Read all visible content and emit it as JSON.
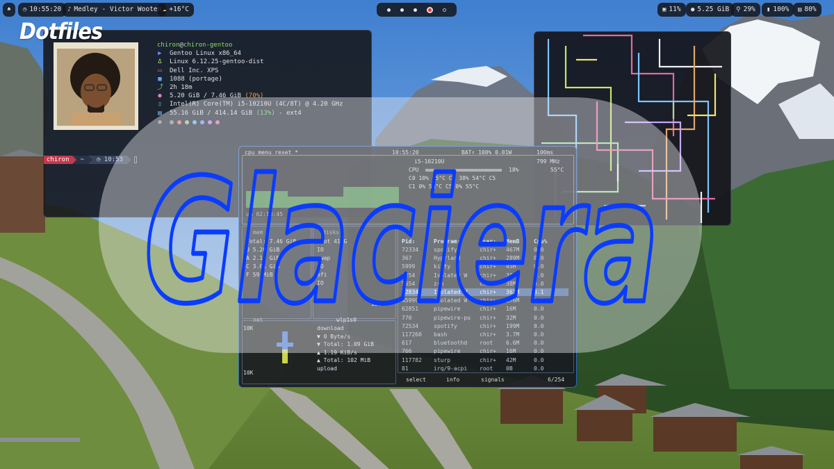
{
  "topbar": {
    "time": "10:55:20",
    "media": "Medley - Victor Wooten",
    "weather": "+16°C",
    "workspaces": [
      "ws1",
      "ws2",
      "ws3",
      "ws4",
      "ws5"
    ],
    "active_workspace": 4,
    "brightness": "11%",
    "memory": "5.25 GiB",
    "cpu": "29%",
    "volume": "100%",
    "battery": "80%"
  },
  "overlay_label": "Dotfiles",
  "logo_text": "Glaciera",
  "fetch": {
    "user": "chiron",
    "host": "chiron-gentoo",
    "rows": [
      {
        "icon": "▶",
        "color": "#6f8cff",
        "text": "Gentoo Linux x86_64"
      },
      {
        "icon": "Δ",
        "color": "#9bd86a",
        "text": "Linux 6.12.25-gentoo-dist"
      },
      {
        "icon": "▭",
        "color": "#e56a8c",
        "text": "Dell Inc. XPS"
      },
      {
        "icon": "■",
        "color": "#5ea8ff",
        "text": "1088 (portage)"
      },
      {
        "icon": "⤴",
        "color": "#7ad27a",
        "text": "2h 18m"
      },
      {
        "icon": "●",
        "color": "#e080c0",
        "text": "5.20 GiB / 7.46 GiB",
        "pct": "(70%)"
      },
      {
        "icon": "▯",
        "color": "#8fa8ff",
        "text": "Intel(R) Core(TM) i5-10210U (4C/8T) @ 4.20 GHz"
      },
      {
        "icon": "▤",
        "color": "#7ec7ff",
        "text": "55.16 GiB / 414.14 GiB",
        "pct": "(13%)",
        "suffix": " - ext4"
      }
    ],
    "palette": [
      "#888888",
      "#e06c75",
      "#98c379",
      "#61afef",
      "#7d8cff",
      "#c678dd",
      "#e06c9c"
    ],
    "prompt": {
      "user": "chiron",
      "dir": "~",
      "time": "10:53"
    }
  },
  "btop": {
    "header_left": "cpu  menu  reset *",
    "clock": "10:55:20",
    "header_right": "BAT↑ 100% 0.01W",
    "freq": "799 MHz",
    "cpu_model": "i5-10210U",
    "cpu_pct": "18%",
    "temp": "55°C",
    "core_rows": [
      "C0  10%  55°C  C4  38%  54°C  C5",
      "C1  0%  53°C  C5  0%  55°C"
    ],
    "uptime": "up 02:18:45",
    "mem_label": "mem",
    "mem_rows": [
      "Total:  7.46 GiB",
      "U    5.26 GiB",
      "A    2.18 GiB",
      "C    3.01 GiB",
      "F    59 MiB"
    ],
    "disk_label": "disks",
    "disk_rows": [
      "root  414G",
      "IO",
      "swap",
      "IO",
      "efi",
      "IO"
    ],
    "disk_io": "156K",
    "proc_header": [
      "Pid:",
      "Program:",
      "User:",
      "MemB",
      "Cpu%"
    ],
    "procs": [
      [
        "72334",
        "spotify",
        "chir+",
        "467M",
        "0.0"
      ],
      [
        "367",
        "Hyprland",
        "chir+",
        "289M",
        "0.0"
      ],
      [
        "5999",
        "kitty",
        "chir+",
        "45M",
        "0.0"
      ],
      [
        "3254",
        "Isolated W",
        "chir+",
        "380M",
        "0.0"
      ],
      [
        "5654",
        "zsh",
        "chir+",
        "38M",
        "0.0"
      ],
      [
        "62834",
        "Isolated W",
        "chir+",
        "361M",
        "3.1"
      ],
      [
        "45999",
        "Isolated W",
        "chir+",
        "176M",
        "0.0"
      ],
      [
        "62851",
        "pipewire",
        "chir+",
        "16M",
        "0.0"
      ],
      [
        "770",
        "pipewire-pu",
        "chir+",
        "32M",
        "0.0"
      ],
      [
        "72534",
        "spotify",
        "chir+",
        "199M",
        "0.0"
      ],
      [
        "117260",
        "bash",
        "chir+",
        "3.7M",
        "0.0"
      ],
      [
        "617",
        "bluetoothd",
        "root",
        "6.6M",
        "0.0"
      ],
      [
        "766",
        "pipewire",
        "chir+",
        "16M",
        "0.0"
      ],
      [
        "117782",
        "sturp",
        "chir+",
        "42M",
        "0.0"
      ],
      [
        "81",
        "irq/9-acpi",
        "root",
        "0B",
        "0.0"
      ]
    ],
    "net_label": "net",
    "net_iface": "wlp1s0",
    "net_scale": "10K",
    "net_rows": [
      "download",
      "▼  0 Byte/s",
      "▼  Total:  1.09 GiB",
      "▲  1.19 KiB/s",
      "▲  Total:  102 MiB",
      "upload"
    ],
    "footer": [
      "select",
      "info",
      "signals"
    ],
    "count": "6/254"
  },
  "colors": {
    "accent_blue": "#0a3cff",
    "bar_bg": "#14161c"
  }
}
